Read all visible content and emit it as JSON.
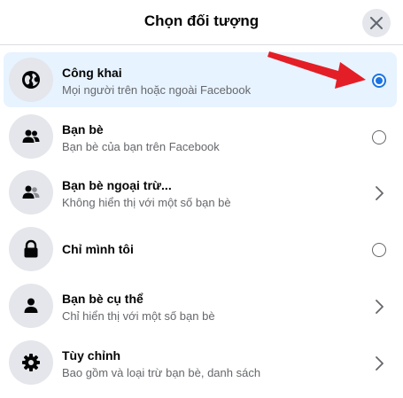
{
  "dialog": {
    "title": "Chọn đối tượng",
    "close_icon": "close-icon"
  },
  "options": [
    {
      "label": "Công khai",
      "desc": "Mọi người trên hoặc ngoài Facebook",
      "icon": "globe-icon",
      "control": "radio",
      "selected": true
    },
    {
      "label": "Bạn bè",
      "desc": "Bạn bè của bạn trên Facebook",
      "icon": "friends-icon",
      "control": "radio",
      "selected": false
    },
    {
      "label": "Bạn bè ngoại trừ...",
      "desc": "Không hiển thị với một số bạn bè",
      "icon": "friends-except-icon",
      "control": "chevron",
      "selected": false
    },
    {
      "label": "Chỉ mình tôi",
      "desc": "",
      "icon": "lock-icon",
      "control": "radio",
      "selected": false
    },
    {
      "label": "Bạn bè cụ thể",
      "desc": "Chỉ hiển thị với một số bạn bè",
      "icon": "person-icon",
      "control": "chevron",
      "selected": false
    },
    {
      "label": "Tùy chỉnh",
      "desc": "Bao gồm và loại trừ bạn bè, danh sách",
      "icon": "gear-icon",
      "control": "chevron",
      "selected": false
    }
  ],
  "colors": {
    "accent": "#1b74e4",
    "selected_row": "#e7f3ff",
    "annotation_arrow": "#e41e26"
  }
}
